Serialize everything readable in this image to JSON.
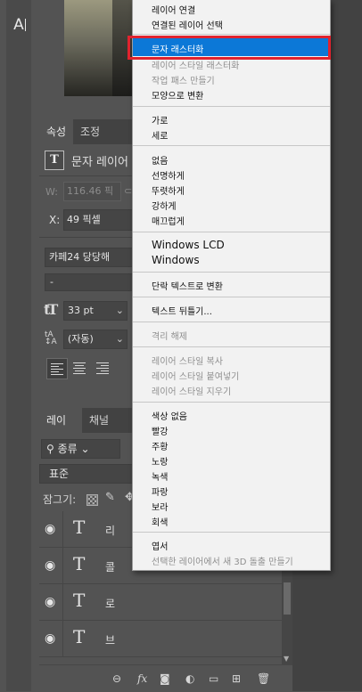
{
  "toolbar": {
    "text_tool_glyph": "A",
    "text_tool_icon": "horizontal-type-tool-icon"
  },
  "properties_panel": {
    "tabs": [
      {
        "label": "속성",
        "active": true
      },
      {
        "label": "조정",
        "active": false
      }
    ],
    "layer_type_icon": "T",
    "layer_type_label": "문자 레이어",
    "w_label": "W:",
    "w_value": "116.46 픽",
    "x_label": "X:",
    "x_value": "49 픽셀",
    "font_family": "카페24 당당해",
    "font_style": "-",
    "font_size": "33 pt",
    "leading": "(자동)",
    "alignment": "left"
  },
  "layers_panel": {
    "tabs": [
      {
        "label": "레이어",
        "active": true
      },
      {
        "label": "채널",
        "active": false
      }
    ],
    "filter_value": "종류",
    "blend_mode": "표준",
    "lock_label": "잠그기:",
    "layers": [
      {
        "name": "리",
        "type_icon": "T",
        "visible": true
      },
      {
        "name": "콜",
        "type_icon": "T",
        "visible": true
      },
      {
        "name": "로",
        "type_icon": "T",
        "visible": true
      },
      {
        "name": "브",
        "type_icon": "T",
        "visible": true
      }
    ],
    "footer_fx": "fx"
  },
  "context_menu": {
    "highlighted": "문자 래스터화",
    "items": [
      {
        "label": "레이어 연결",
        "enabled": true
      },
      {
        "label": "연결된 레이어 선택",
        "enabled": true
      },
      {
        "label": "문자 래스터화",
        "enabled": true
      },
      {
        "label": "레이어 스타일 래스터화",
        "enabled": false
      },
      {
        "label": "작업 패스 만들기",
        "enabled": false
      },
      {
        "label": "모양으로 변환",
        "enabled": true
      },
      {
        "label": "가로",
        "enabled": true
      },
      {
        "label": "세로",
        "enabled": true
      },
      {
        "label": "없음",
        "enabled": true
      },
      {
        "label": "선명하게",
        "enabled": true
      },
      {
        "label": "뚜렷하게",
        "enabled": true
      },
      {
        "label": "강하게",
        "enabled": true
      },
      {
        "label": "매끄럽게",
        "enabled": true
      },
      {
        "label": "Windows LCD",
        "enabled": true
      },
      {
        "label": "Windows",
        "enabled": true
      },
      {
        "label": "단락 텍스트로 변환",
        "enabled": true
      },
      {
        "label": "텍스트 뒤틀기...",
        "enabled": true
      },
      {
        "label": "격리 해제",
        "enabled": false
      },
      {
        "label": "레이어 스타일 복사",
        "enabled": false
      },
      {
        "label": "레이어 스타일 붙여넣기",
        "enabled": false
      },
      {
        "label": "레이어 스타일 지우기",
        "enabled": false
      },
      {
        "label": "색상 없음",
        "enabled": true
      },
      {
        "label": "빨강",
        "enabled": true
      },
      {
        "label": "주황",
        "enabled": true
      },
      {
        "label": "노랑",
        "enabled": true
      },
      {
        "label": "녹색",
        "enabled": true
      },
      {
        "label": "파랑",
        "enabled": true
      },
      {
        "label": "보라",
        "enabled": true
      },
      {
        "label": "회색",
        "enabled": true
      },
      {
        "label": "엽서",
        "enabled": true
      },
      {
        "label": "선택한 레이어에서 새 3D 돌출 만들기",
        "enabled": false
      }
    ]
  },
  "colors": {
    "menu_highlight": "#0c78d7",
    "callout_border": "#e0232e",
    "panel_bg": "#535353"
  }
}
